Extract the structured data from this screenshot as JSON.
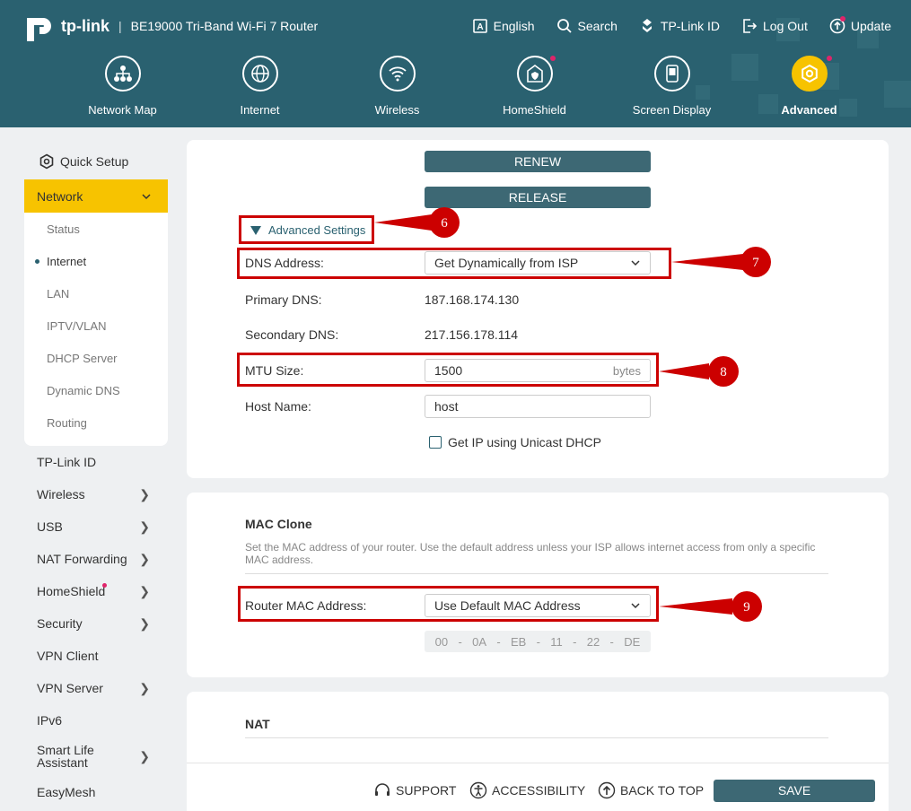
{
  "header": {
    "brand": "tp-link",
    "model": "BE19000 Tri-Band Wi-Fi 7 Router",
    "links": [
      {
        "icon": "language-icon",
        "label": "English"
      },
      {
        "icon": "search-icon",
        "label": "Search"
      },
      {
        "icon": "tplink-id-icon",
        "label": "TP-Link ID"
      },
      {
        "icon": "logout-icon",
        "label": "Log Out"
      },
      {
        "icon": "update-icon",
        "label": "Update"
      }
    ],
    "nav": [
      {
        "icon": "network-map-icon",
        "label": "Network Map"
      },
      {
        "icon": "internet-icon",
        "label": "Internet"
      },
      {
        "icon": "wireless-icon",
        "label": "Wireless"
      },
      {
        "icon": "homeshield-icon",
        "label": "HomeShield"
      },
      {
        "icon": "screen-display-icon",
        "label": "Screen Display"
      },
      {
        "icon": "advanced-icon",
        "label": "Advanced"
      }
    ]
  },
  "sidebar": {
    "quick_setup": "Quick Setup",
    "network": "Network",
    "network_sub": [
      "Status",
      "Internet",
      "LAN",
      "IPTV/VLAN",
      "DHCP Server",
      "Dynamic DNS",
      "Routing"
    ],
    "items": [
      "TP-Link ID",
      "Wireless",
      "USB",
      "NAT Forwarding",
      "HomeShield",
      "Security",
      "VPN Client",
      "VPN Server",
      "IPv6",
      "Smart Life Assistant",
      "EasyMesh"
    ]
  },
  "internet": {
    "renew": "RENEW",
    "release": "RELEASE",
    "advanced_settings": "Advanced Settings",
    "dns_label": "DNS Address:",
    "dns_value": "Get Dynamically from ISP",
    "primary_dns_label": "Primary DNS:",
    "primary_dns": "187.168.174.130",
    "secondary_dns_label": "Secondary DNS:",
    "secondary_dns": "217.156.178.114",
    "mtu_label": "MTU Size:",
    "mtu_value": "1500",
    "mtu_unit": "bytes",
    "host_label": "Host Name:",
    "host_value": "host",
    "unicast_label": "Get IP using Unicast DHCP"
  },
  "mac_clone": {
    "title": "MAC Clone",
    "desc": "Set the MAC address of your router. Use the default address unless your ISP allows internet access from only a specific MAC address.",
    "router_mac_label": "Router MAC Address:",
    "router_mac_value": "Use Default MAC Address",
    "mac_parts": [
      "00",
      "-",
      "0A",
      "-",
      "EB",
      "-",
      "11",
      "-",
      "22",
      "-",
      "DE"
    ]
  },
  "nat": {
    "title": "NAT"
  },
  "callouts": [
    "6",
    "7",
    "8",
    "9"
  ],
  "footer": {
    "support": "SUPPORT",
    "accessibility": "ACCESSIBILITY",
    "back_to_top": "BACK TO TOP",
    "save": "SAVE"
  },
  "colors": {
    "header_bg": "#2a6170",
    "accent_yellow": "#f7c300",
    "button_dark": "#3d6874",
    "callout_red": "#cc0000"
  }
}
